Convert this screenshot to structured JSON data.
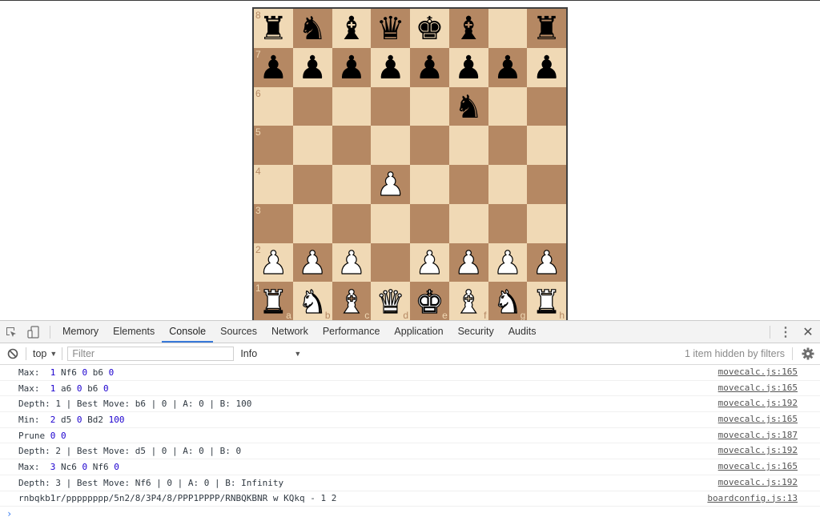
{
  "board": {
    "orientation": "white",
    "fen": "rnbqkb1r/pppppppp/5n2/8/3P4/8/PPP1PPPP/RNBQKBNR w KQkq - 1 2",
    "colors": {
      "light": "#f0d9b5",
      "dark": "#b58863"
    },
    "ranks": [
      "8",
      "7",
      "6",
      "5",
      "4",
      "3",
      "2",
      "1"
    ],
    "files": [
      "a",
      "b",
      "c",
      "d",
      "e",
      "f",
      "g",
      "h"
    ],
    "rows": [
      [
        "r",
        "n",
        "b",
        "q",
        "k",
        "b",
        "",
        "r"
      ],
      [
        "p",
        "p",
        "p",
        "p",
        "p",
        "p",
        "p",
        "p"
      ],
      [
        "",
        "",
        "",
        "",
        "",
        "n",
        "",
        ""
      ],
      [
        "",
        "",
        "",
        "",
        "",
        "",
        "",
        ""
      ],
      [
        "",
        "",
        "",
        "P",
        "",
        "",
        "",
        ""
      ],
      [
        "",
        "",
        "",
        "",
        "",
        "",
        "",
        ""
      ],
      [
        "P",
        "P",
        "P",
        "",
        "P",
        "P",
        "P",
        "P"
      ],
      [
        "R",
        "N",
        "B",
        "Q",
        "K",
        "B",
        "N",
        "R"
      ]
    ],
    "glyphs": {
      "k": "♚",
      "q": "♛",
      "r": "♜",
      "b": "♝",
      "n": "♞",
      "p": "♟",
      "K": "♚",
      "Q": "♛",
      "R": "♜",
      "B": "♝",
      "N": "♞",
      "P": "♟"
    }
  },
  "devtools": {
    "left_icons": [
      "inspect-element-icon",
      "device-toolbar-icon"
    ],
    "tabs": [
      {
        "label": "Memory",
        "active": false
      },
      {
        "label": "Elements",
        "active": false
      },
      {
        "label": "Console",
        "active": true
      },
      {
        "label": "Sources",
        "active": false
      },
      {
        "label": "Network",
        "active": false
      },
      {
        "label": "Performance",
        "active": false
      },
      {
        "label": "Application",
        "active": false
      },
      {
        "label": "Security",
        "active": false
      },
      {
        "label": "Audits",
        "active": false
      }
    ],
    "more_icon": "⋮",
    "close_icon": "✕",
    "accent": "#3879d9",
    "toolbar": {
      "context": "top",
      "filter_placeholder": "Filter",
      "filter_value": "",
      "level": "Info",
      "hidden_info": "1 item hidden by filters"
    },
    "console": {
      "rows": [
        {
          "parts": [
            {
              "t": "Max:  "
            },
            {
              "t": "1",
              "num": true
            },
            {
              "t": " Nf6 "
            },
            {
              "t": "0",
              "num": true
            },
            {
              "t": " b6 "
            },
            {
              "t": "0",
              "num": true
            }
          ],
          "source": "movecalc.js:165"
        },
        {
          "parts": [
            {
              "t": "Max:  "
            },
            {
              "t": "1",
              "num": true
            },
            {
              "t": " a6 "
            },
            {
              "t": "0",
              "num": true
            },
            {
              "t": " b6 "
            },
            {
              "t": "0",
              "num": true
            }
          ],
          "source": "movecalc.js:165"
        },
        {
          "parts": [
            {
              "t": "Depth: 1 | Best Move: b6 | 0 | A: 0 | B: 100"
            }
          ],
          "source": "movecalc.js:192"
        },
        {
          "parts": [
            {
              "t": "Min:  "
            },
            {
              "t": "2",
              "num": true
            },
            {
              "t": " d5 "
            },
            {
              "t": "0",
              "num": true
            },
            {
              "t": " Bd2 "
            },
            {
              "t": "100",
              "num": true
            }
          ],
          "source": "movecalc.js:165"
        },
        {
          "parts": [
            {
              "t": "Prune "
            },
            {
              "t": "0",
              "num": true
            },
            {
              "t": " "
            },
            {
              "t": "0",
              "num": true
            }
          ],
          "source": "movecalc.js:187"
        },
        {
          "parts": [
            {
              "t": "Depth: 2 | Best Move: d5 | 0 | A: 0 | B: 0"
            }
          ],
          "source": "movecalc.js:192"
        },
        {
          "parts": [
            {
              "t": "Max:  "
            },
            {
              "t": "3",
              "num": true
            },
            {
              "t": " Nc6 "
            },
            {
              "t": "0",
              "num": true
            },
            {
              "t": " Nf6 "
            },
            {
              "t": "0",
              "num": true
            }
          ],
          "source": "movecalc.js:165"
        },
        {
          "parts": [
            {
              "t": "Depth: 3 | Best Move: Nf6 | 0 | A: 0 | B: Infinity"
            }
          ],
          "source": "movecalc.js:192"
        },
        {
          "parts": [
            {
              "t": "rnbqkb1r/pppppppp/5n2/8/3P4/8/PPP1PPPP/RNBQKBNR w KQkq - 1 2"
            }
          ],
          "source": "boardconfig.js:13"
        }
      ],
      "prompt": "›"
    }
  }
}
